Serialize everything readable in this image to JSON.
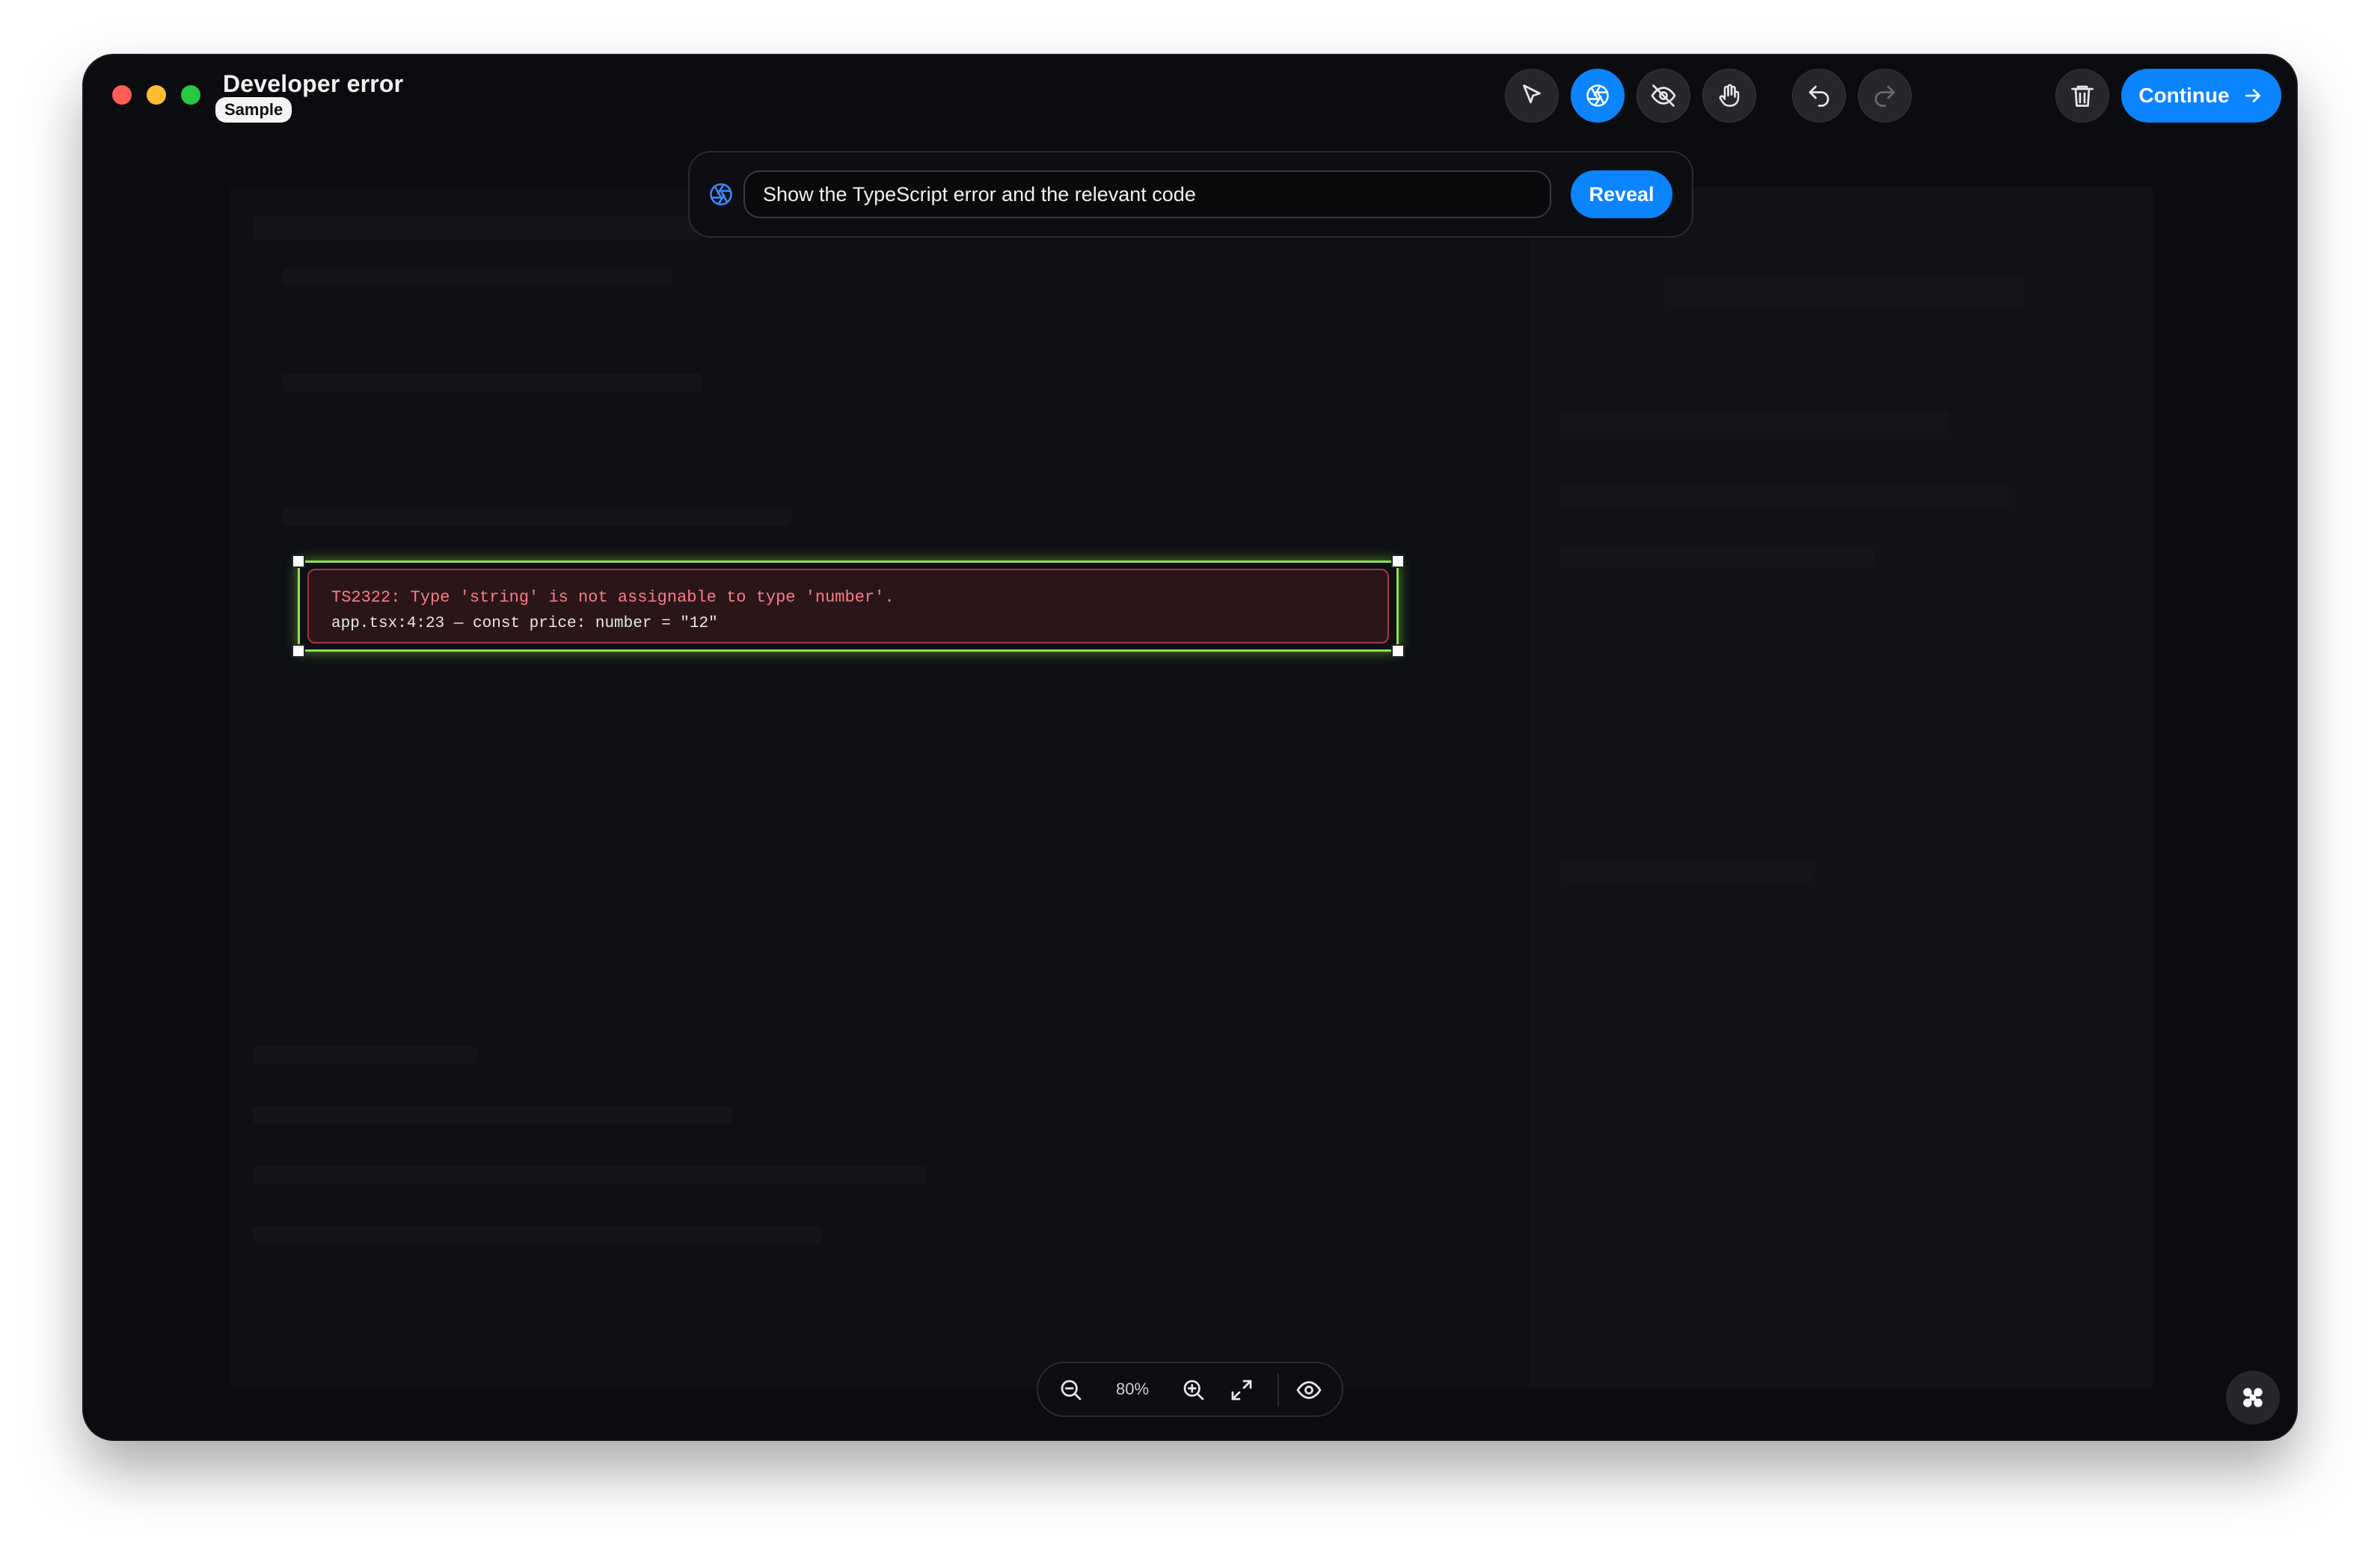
{
  "window": {
    "title": "Developer error",
    "badge": "Sample"
  },
  "toolbar": {
    "tools": [
      {
        "name": "select-tool",
        "icon": "cursor-arrow-icon",
        "active": false
      },
      {
        "name": "reveal-tool",
        "icon": "aperture-icon",
        "active": true
      },
      {
        "name": "hide-tool",
        "icon": "eye-off-icon",
        "active": false
      },
      {
        "name": "pan-tool",
        "icon": "hand-icon",
        "active": false
      },
      {
        "name": "undo",
        "icon": "undo-icon",
        "active": false
      },
      {
        "name": "redo",
        "icon": "redo-icon",
        "active": false
      },
      {
        "name": "delete",
        "icon": "trash-icon",
        "active": false
      }
    ],
    "continue_label": "Continue"
  },
  "prompt": {
    "value": "Show the TypeScript error and the relevant code",
    "button_label": "Reveal"
  },
  "error_box": {
    "line1": "TS2322: Type 'string' is not assignable to type 'number'.",
    "line2": "app.tsx:4:23 — const price: number = \"12\""
  },
  "zoom": {
    "value": "80%"
  },
  "colors": {
    "accent": "#0a84ff",
    "selection": "#8ee04a",
    "error_text": "#ff7b86",
    "background": "#0b0c0f"
  }
}
